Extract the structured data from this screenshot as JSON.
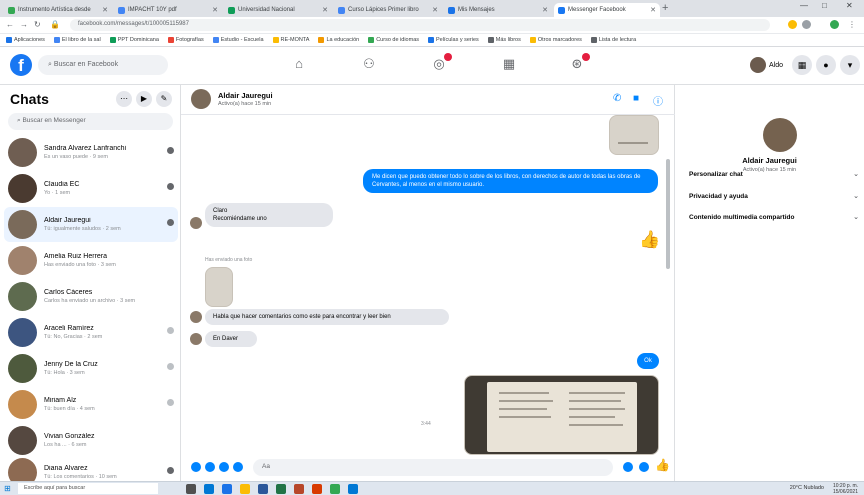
{
  "browser": {
    "tabs": [
      {
        "title": "Instrumento Artística desde",
        "color": "#34a853"
      },
      {
        "title": "IMPACHT 10Y pdf",
        "color": "#4285f4"
      },
      {
        "title": "Universidad Nacional",
        "color": "#0f9d58"
      },
      {
        "title": "Curso Lápices Primer libro",
        "color": "#4285f4"
      },
      {
        "title": "Mis Mensajes",
        "color": "#1a73e8"
      },
      {
        "title": "Messenger Facebook",
        "color": "#1877f2"
      }
    ],
    "new_tab": "+",
    "window_controls": [
      "—",
      "□",
      "✕"
    ],
    "url": "facebook.com/messages/t/100005115987",
    "bookmarks": [
      "Aplicaciones",
      "El libro de la sal",
      "PPT Dominicana",
      "Fotografías",
      "Estudio - Escuela",
      "RE-MONTA",
      "La educación",
      "Curso de idiomas",
      "Películas y series",
      "Más libros",
      "Otros marcadores",
      "Lista de lectura"
    ]
  },
  "facebook": {
    "logo": "f",
    "search_placeholder": "Buscar en Facebook",
    "user_name": "Aldo",
    "nav_icons": [
      "home-icon",
      "friends-icon",
      "groups-icon",
      "marketplace-icon",
      "gaming-icon"
    ]
  },
  "sidebar": {
    "title": "Chats",
    "search_placeholder": "Buscar en Messenger",
    "chats": [
      {
        "name": "Sandra Alvarez Lanfranchi",
        "preview": "Es un vaso puede · 9 sem",
        "avatar_color": "#6f5e52"
      },
      {
        "name": "Claudia EC",
        "preview": "Yo · 1 sem",
        "avatar_color": "#4a3a30"
      },
      {
        "name": "Aldair Jauregui",
        "preview": "Tú: igualmente saludos · 2 sem",
        "avatar_color": "#7a6a5a",
        "selected": true
      },
      {
        "name": "Amelia Ruiz Herrera",
        "preview": "Has enviado una foto · 3 sem",
        "avatar_color": "#a0826d"
      },
      {
        "name": "Carlos Cáceres",
        "preview": "Carlos ha enviado un archivo · 3 sem",
        "avatar_color": "#5e6b4f"
      },
      {
        "name": "Araceli Ramírez",
        "preview": "Tú: No, Gracias · 2 sem",
        "avatar_color": "#3d5580"
      },
      {
        "name": "Jenny De la Cruz",
        "preview": "Tú: Hola · 3 sem",
        "avatar_color": "#4e5a3d"
      },
      {
        "name": "Miriam Alz",
        "preview": "Tú: buen día · 4 sem",
        "avatar_color": "#c58a4c"
      },
      {
        "name": "Vivian González",
        "preview": "Los ha ... · 6 sem",
        "avatar_color": "#554840"
      },
      {
        "name": "Diana Álvarez",
        "preview": "Tú: Los comentarios · 10 sem",
        "avatar_color": "#8d6a52"
      }
    ]
  },
  "conversation": {
    "contact_name": "Aldair Jauregui",
    "contact_status": "Activo(a) hace 15 min",
    "messages": {
      "outgoing_1": "Me dicen que puedo obtener todo lo sobre de los libros, con derechos de autor de todas las obras de Cervantes, al menos en el mismo usuario.",
      "incoming_1_line1": "Claro",
      "incoming_1_line2": "Recomiéndame uno",
      "incoming_2": "Habla que hacer comentarios como este para encontrar y leer bien",
      "incoming_3": "En Daver",
      "ok_label": "Ok",
      "shared_label": "Has enviado una foto",
      "seen": "3:44"
    },
    "composer_placeholder": "Aa"
  },
  "info_panel": {
    "name": "Aldair Jauregui",
    "status": "Activo(a) hace 15 min",
    "rows": [
      "Personalizar chat",
      "Privacidad y ayuda",
      "Contenido multimedia compartido"
    ]
  },
  "taskbar": {
    "search_placeholder": "Escribe aquí para buscar",
    "tray": "20°C Nublado",
    "time": "10:20 p. m.",
    "date": "15/06/2021"
  },
  "colors": {
    "messenger_blue": "#0084ff",
    "facebook_blue": "#1877f2",
    "bubble_gray": "#e4e6eb"
  }
}
